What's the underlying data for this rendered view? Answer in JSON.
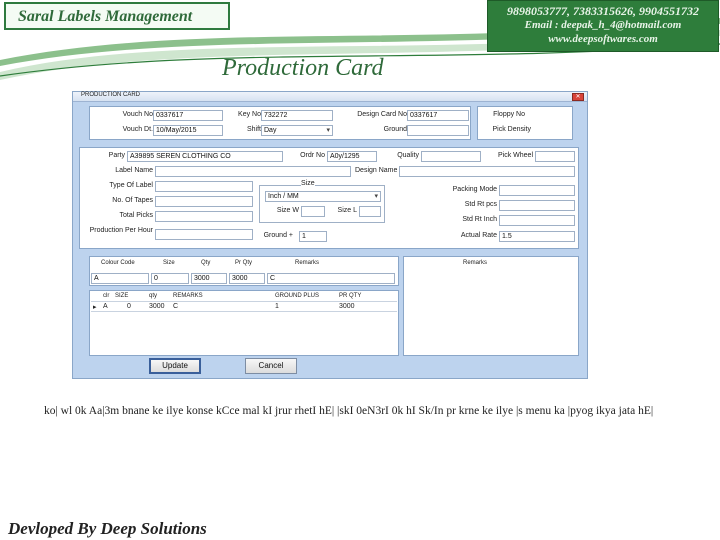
{
  "slide": {
    "brand": "Saral Labels Management",
    "contact": {
      "phones": "9898053777, 7383315626, 9904551732",
      "email": "Email : deepak_h_4@hotmail.com",
      "web": "www.deepsoftwares.com"
    },
    "title": "Production Card",
    "body": "ko| wl 0k Aa|3m bnane ke ilye konse kCce mal kI jrur rhetI hE| |skI 0eN3rI 0k hI Sk/In pr krne ke ilye |s menu ka |pyog ikya jata hE|",
    "footer": "Devloped By Deep Solutions"
  },
  "colors": {
    "accent_green": "#2e7d3b",
    "window_bg": "#bdd3ee"
  },
  "window": {
    "title": "PRODUCTION CARD",
    "close_icon": "close-icon",
    "header": {
      "vouch_no_label": "Vouch No",
      "vouch_no": "0337617",
      "key_no_label": "Key No",
      "key_no": "732272",
      "design_card_no_label": "Design Card No",
      "design_card_no": "0337617",
      "floppy_no_label": "Floppy No",
      "vouch_dt_label": "Vouch Dt.",
      "vouch_dt": "10/May/2015",
      "shift_label": "Shift",
      "shift": "Day",
      "ground_label": "Ground",
      "pick_density_label": "Pick Density"
    },
    "details": {
      "party_label": "Party",
      "party": "A39895 SEREN CLOTHING CO",
      "ordr_no_label": "Ordr No",
      "ordr_no": "A0y/1295",
      "quality_label": "Quality",
      "pick_wheel_label": "Pick Wheel",
      "label_name_label": "Label Name",
      "design_name_label": "Design Name",
      "type_of_label_label": "Type Of Label",
      "size_group_label": "Size",
      "size_unit": "Inch / MM",
      "size_w_label": "Size W",
      "size_l_label": "Size L",
      "packing_mode_label": "Packing Mode",
      "no_of_tapes_label": "No. Of Tapes",
      "std_rt_pcs_label": "Std Rt pcs",
      "total_picks_label": "Total Picks",
      "std_rt_inch_label": "Std Rt Inch",
      "production_per_hour_label": "Production Per Hour",
      "ground_plus_label": "Ground +",
      "ground_plus": "1",
      "actual_rate_label": "Actual Rate",
      "actual_rate": "1.5"
    },
    "entry_row": {
      "headers": [
        "Colour Code",
        "Size",
        "Qty",
        "Pr Qty",
        "Remarks"
      ],
      "values": [
        "A",
        "0",
        "3000",
        "3000",
        "C"
      ],
      "remarks_panel_header": "Remarks"
    },
    "grid": {
      "headers": [
        "clr",
        "SIZE",
        "qty",
        "REMARKS",
        "GROUND PLUS",
        "PR QTY"
      ],
      "rows": [
        [
          "A",
          "0",
          "3000",
          "C",
          "1",
          "3000"
        ]
      ]
    },
    "buttons": {
      "update": "Update",
      "cancel": "Cancel"
    }
  }
}
